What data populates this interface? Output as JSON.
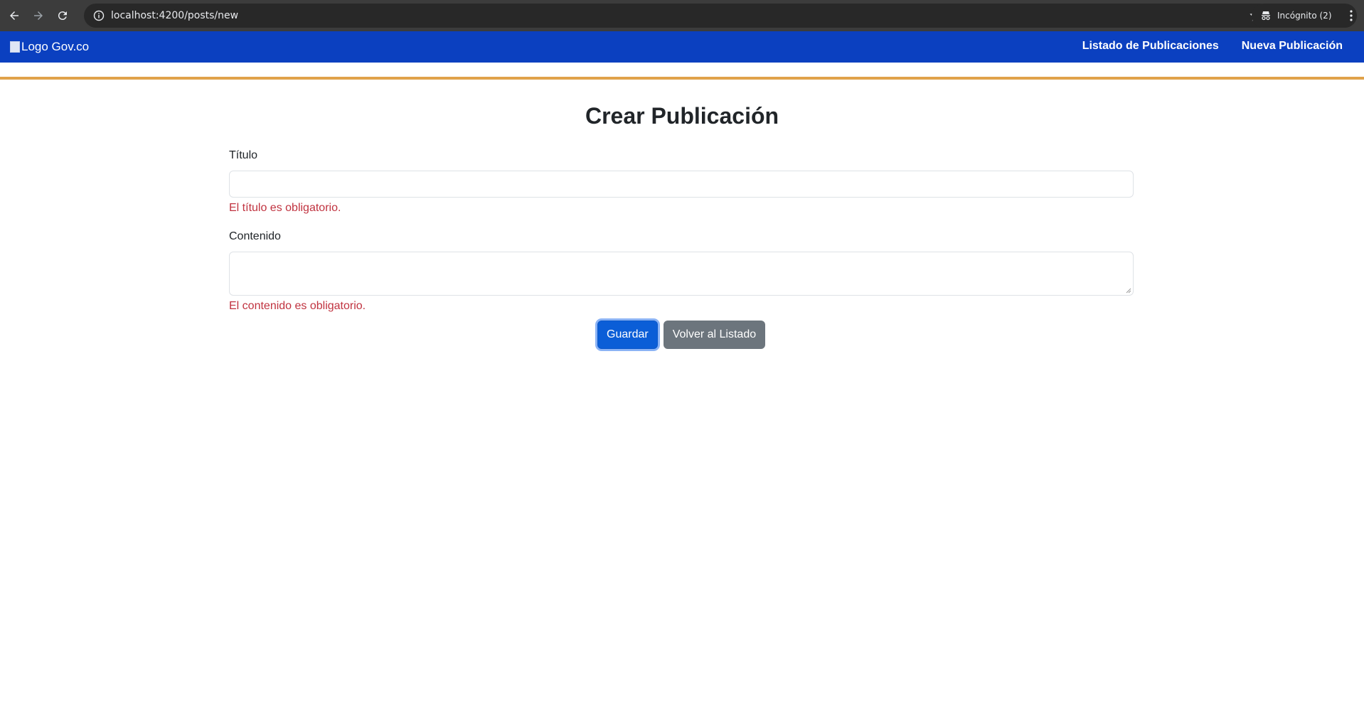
{
  "browser": {
    "url": "localhost:4200/posts/new",
    "incognito_label": "Incógnito (2)"
  },
  "navbar": {
    "logo_alt": "Logo Gov.co",
    "links": [
      "Listado de Publicaciones",
      "Nueva Publicación"
    ],
    "bg_color": "#0b40c0",
    "accent_line_color": "#e0a24a"
  },
  "form": {
    "title": "Crear Publicación",
    "fields": {
      "titulo": {
        "label": "Título",
        "value": "",
        "error": "El título es obligatorio."
      },
      "contenido": {
        "label": "Contenido",
        "value": "",
        "error": "El contenido es obligatorio."
      }
    },
    "buttons": {
      "save": "Guardar",
      "back": "Volver al Listado"
    }
  }
}
